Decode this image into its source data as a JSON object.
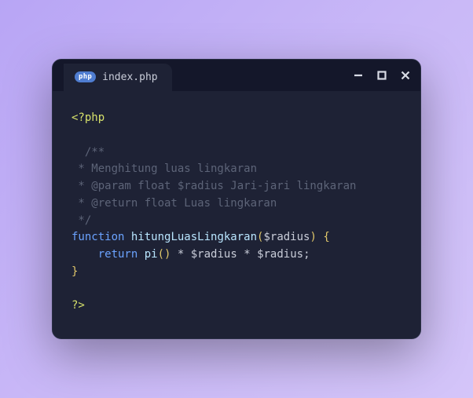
{
  "tab": {
    "icon_label": "php",
    "filename": "index.php"
  },
  "code": {
    "open_tag": "<?php",
    "comment_open": "  /**",
    "comment_l1": " * Menghitung luas lingkaran",
    "comment_l2": " * @param float $radius Jari-jari lingkaran",
    "comment_l3": " * @return float Luas lingkaran",
    "comment_close": " */",
    "kw_function": "function",
    "fn_name": "hitungLuasLingkaran",
    "paren_open": "(",
    "param": "$radius",
    "paren_close": ")",
    "brace_open": "{",
    "kw_return": "return",
    "call_pi": "pi",
    "call_paren": "()",
    "op_mul1": " * ",
    "var_r1": "$radius",
    "op_mul2": " * ",
    "var_r2": "$radius",
    "semicolon": ";",
    "brace_close": "}",
    "close_tag": "?>"
  }
}
